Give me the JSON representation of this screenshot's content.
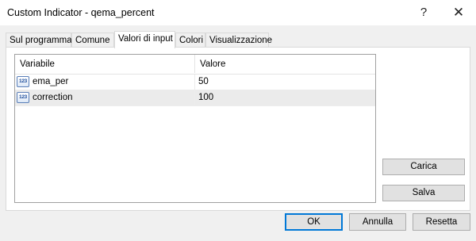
{
  "window": {
    "title": "Custom Indicator - qema_percent",
    "help_glyph": "?",
    "close_glyph": "✕"
  },
  "tabs": [
    {
      "label": "Sul programma"
    },
    {
      "label": "Comune"
    },
    {
      "label": "Valori di input",
      "active": true
    },
    {
      "label": "Colori"
    },
    {
      "label": "Visualizzazione"
    }
  ],
  "grid": {
    "headers": {
      "variable": "Variabile",
      "value": "Valore"
    },
    "icon_text": "123",
    "rows": [
      {
        "name": "ema_per",
        "value": "50",
        "selected": false
      },
      {
        "name": "correction",
        "value": "100",
        "selected": true
      }
    ]
  },
  "side_buttons": {
    "load": "Carica",
    "save": "Salva"
  },
  "footer": {
    "ok": "OK",
    "cancel": "Annulla",
    "reset": "Resetta"
  }
}
